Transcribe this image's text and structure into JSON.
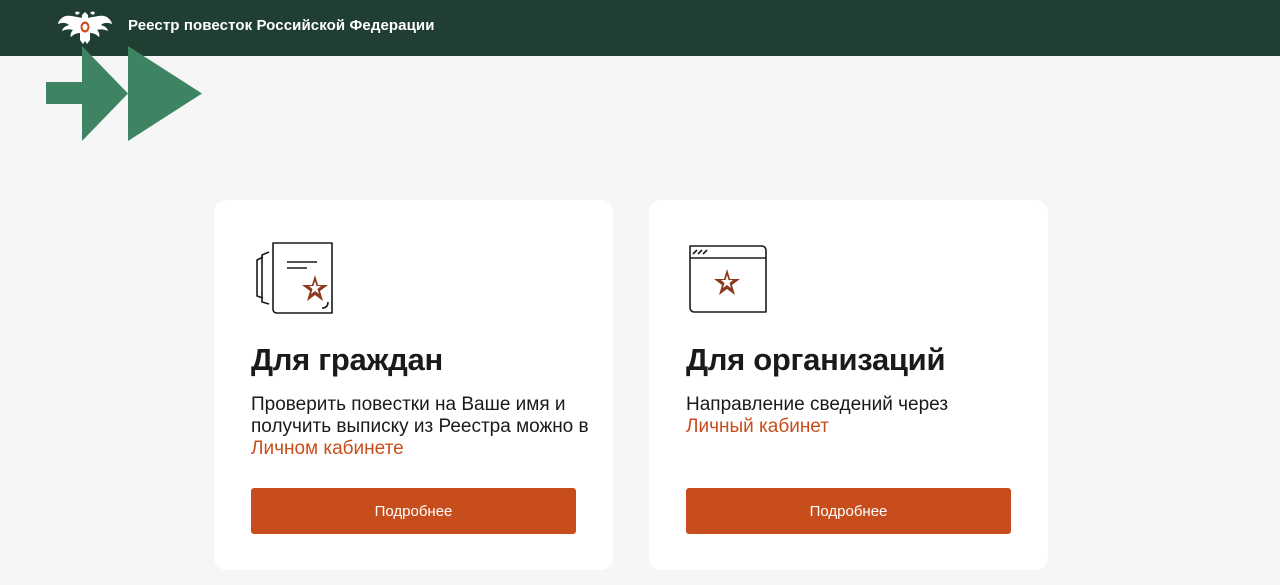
{
  "header": {
    "title": "Реестр повесток Российской Федерации",
    "emblem_icon": "double-headed-eagle-icon",
    "background": "#203f32"
  },
  "decoration": {
    "arrows_icon": "double-chevron-right-icon",
    "color": "#3f8462"
  },
  "cards": [
    {
      "icon": "document-star-icon",
      "title": "Для граждан",
      "text": "Проверить повестки на Ваше имя и получить выписку из Реестра можно в ",
      "link_label": "Личном кабинете",
      "button_label": "Подробнее"
    },
    {
      "icon": "browser-star-icon",
      "title": "Для организаций",
      "text": "Направление сведений через ",
      "link_label": "Личный кабинет",
      "button_label": "Подробнее"
    }
  ],
  "colors": {
    "accent": "#c84d1c",
    "star": "#8a3a1e",
    "page_background": "#f6f6f6"
  }
}
